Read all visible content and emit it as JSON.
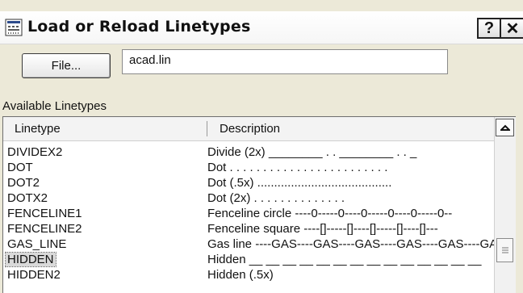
{
  "window": {
    "title": "Load or Reload Linetypes",
    "icon": "linetype-dialog-icon",
    "help_label": "?",
    "close_label": "✕"
  },
  "file": {
    "button_label": "File...",
    "filename": "acad.lin"
  },
  "list": {
    "section_label": "Available Linetypes",
    "columns": [
      "Linetype",
      "Description"
    ],
    "rows": [
      {
        "name": "DIVIDEX2",
        "desc": "Divide (2x) ________  . .  ________  . .  _"
      },
      {
        "name": "DOT",
        "desc": "Dot . . . . . . . . . . . . . . . . . . . . . . . ."
      },
      {
        "name": "DOT2",
        "desc": "Dot (.5x) ........................................"
      },
      {
        "name": "DOTX2",
        "desc": "Dot (2x) .  .  .  .  .  .  .  .  .  .  .  .  .  ."
      },
      {
        "name": "FENCELINE1",
        "desc": "Fenceline circle ----0-----0----0-----0----0-----0--"
      },
      {
        "name": "FENCELINE2",
        "desc": "Fenceline square ----[]-----[]----[]-----[]----[]---"
      },
      {
        "name": "GAS_LINE",
        "desc": "Gas line ----GAS----GAS----GAS----GAS----GAS----GAS--"
      },
      {
        "name": "HIDDEN",
        "desc": "Hidden __ __ __ __ __ __ __ __ __ __ __ __ __ __"
      },
      {
        "name": "HIDDEN2",
        "desc": "Hidden (.5x)"
      }
    ],
    "selected_index": 7
  },
  "icons": {
    "scroll_up": "chevron-up-icon",
    "thumb_grip": "grip-icon"
  },
  "colors": {
    "dialog_bg": "#ece9d8",
    "selection": "#d9d9d9"
  }
}
